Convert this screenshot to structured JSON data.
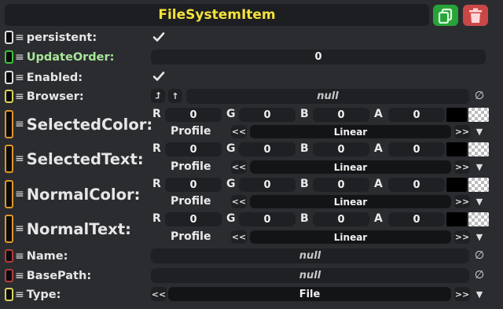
{
  "header": {
    "title": "FileSystemItem"
  },
  "fields": {
    "persistent": {
      "label": "persistent:"
    },
    "update_order": {
      "label": "UpdateOrder:",
      "value": "0"
    },
    "enabled": {
      "label": "Enabled:"
    },
    "browser": {
      "label": "Browser:",
      "value": "null"
    },
    "selected_color": {
      "label": "SelectedColor:",
      "r": "0",
      "g": "0",
      "b": "0",
      "a": "0",
      "profile_label": "Profile",
      "profile_value": "Linear"
    },
    "selected_text": {
      "label": "SelectedText:",
      "r": "0",
      "g": "0",
      "b": "0",
      "a": "0",
      "profile_label": "Profile",
      "profile_value": "Linear"
    },
    "normal_color": {
      "label": "NormalColor:",
      "r": "0",
      "g": "0",
      "b": "0",
      "a": "0",
      "profile_label": "Profile",
      "profile_value": "Linear"
    },
    "normal_text": {
      "label": "NormalText:",
      "r": "0",
      "g": "0",
      "b": "0",
      "a": "0",
      "profile_label": "Profile",
      "profile_value": "Linear"
    },
    "name": {
      "label": "Name:",
      "value": "null"
    },
    "base_path": {
      "label": "BasePath:",
      "value": "null"
    },
    "type": {
      "label": "Type:",
      "value": "File"
    }
  },
  "channels": {
    "r": "R",
    "g": "G",
    "b": "B",
    "a": "A"
  },
  "buttons": {
    "prev": "<<",
    "next": ">>",
    "dropdown": "▼",
    "null_symbol": "∅",
    "jump_up": "⮥",
    "up": "↑"
  },
  "colors": {
    "title": "#f5e23c",
    "duplicate_button": "#27a33a",
    "delete_button": "#c94747",
    "grip_white": "#dcdcdc",
    "grip_green": "#3cc43c",
    "grip_yellow": "#d8d25a",
    "grip_orange": "#e0962c",
    "grip_red": "#b43c3c"
  },
  "icons": {
    "duplicate": "duplicate-icon",
    "delete": "trash-icon",
    "check": "check-icon",
    "null": "null-icon",
    "hamburger": "hamburger-icon",
    "grip": "grip-icon"
  }
}
